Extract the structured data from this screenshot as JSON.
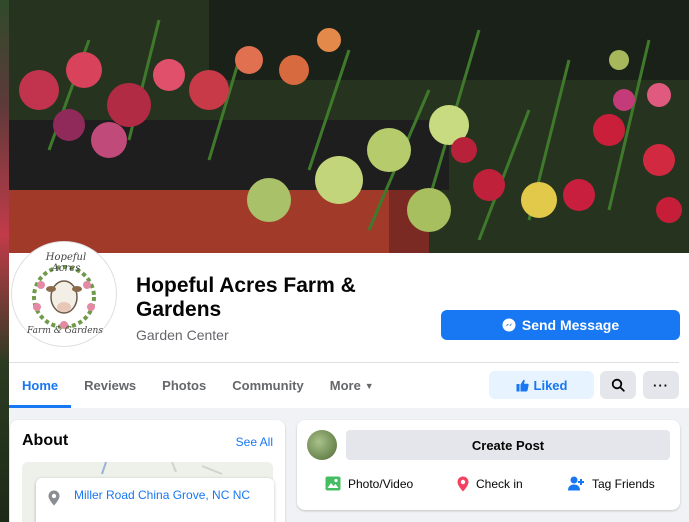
{
  "page": {
    "name": "Hopeful Acres Farm & Gardens",
    "category": "Garden Center",
    "avatar_lines": [
      "Hopeful Acres",
      "Farm & Gardens"
    ]
  },
  "actions": {
    "send_message": "Send Message",
    "liked": "Liked"
  },
  "tabs": [
    {
      "label": "Home",
      "active": true
    },
    {
      "label": "Reviews"
    },
    {
      "label": "Photos"
    },
    {
      "label": "Community"
    },
    {
      "label": "More"
    }
  ],
  "about": {
    "title": "About",
    "see_all": "See All",
    "address": "Miller Road China Grove, NC NC"
  },
  "composer": {
    "create_post": "Create Post",
    "photo_video": "Photo/Video",
    "check_in": "Check in",
    "tag_friends": "Tag Friends"
  },
  "colors": {
    "primary": "#1877f2",
    "liked_bg": "#e7f3ff",
    "secondary_text": "#65676b",
    "photo_green": "#45bd62",
    "checkin_red": "#f3425f"
  },
  "icons": {
    "messenger": "messenger-icon",
    "like": "thumbs-up-icon",
    "search": "search-icon",
    "more": "ellipsis-icon",
    "pin": "location-pin-icon",
    "photo": "photo-icon",
    "checkin": "check-in-pin-icon",
    "tag": "tag-friends-icon"
  }
}
